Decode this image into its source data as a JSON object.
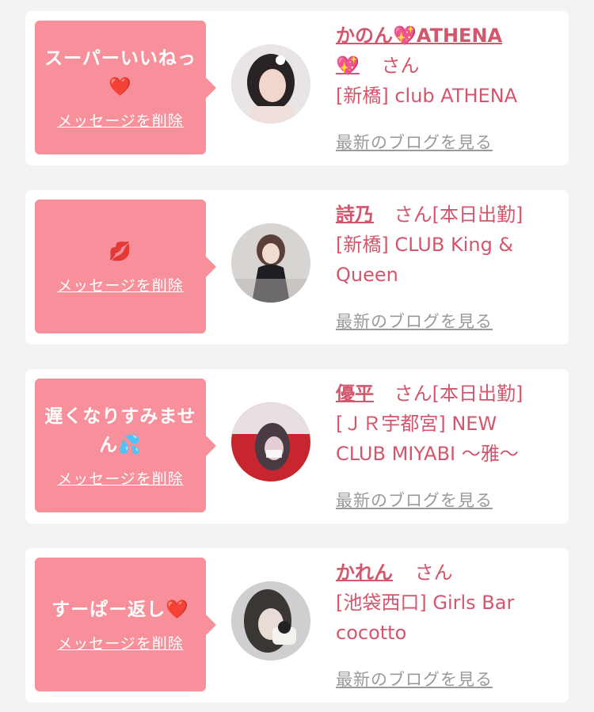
{
  "items": [
    {
      "message": "スーパーいいねっ",
      "message_emoji": "❤️",
      "delete_label": "メッセージを削除",
      "name": "かのん💖ATHENA",
      "name_cont": "💖",
      "suffix": "さん",
      "shop": "[新橋] club ATHENA",
      "shop2": "",
      "blog_label": "最新のブログを見る"
    },
    {
      "message": "",
      "message_emoji": "💋",
      "delete_label": "メッセージを削除",
      "name": "詩乃",
      "name_cont": "",
      "suffix": "さん[本日出勤]",
      "shop": "[新橋] CLUB King &",
      "shop2": "Queen",
      "blog_label": "最新のブログを見る"
    },
    {
      "message": "遅くなりすみませ",
      "message_emoji": "ん💦",
      "delete_label": "メッセージを削除",
      "name": "優平",
      "name_cont": "",
      "suffix": "さん[本日出勤]",
      "shop": "[ＪＲ宇都宮] NEW",
      "shop2": "CLUB MIYABI 〜雅〜",
      "blog_label": "最新のブログを見る"
    },
    {
      "message": "すーぱー返し❤️",
      "message_emoji": "",
      "delete_label": "メッセージを削除",
      "name": "かれん",
      "name_cont": "",
      "suffix": "さん",
      "shop": "[池袋西口] Girls Bar",
      "shop2": "cocotto",
      "blog_label": "最新のブログを見る"
    }
  ]
}
